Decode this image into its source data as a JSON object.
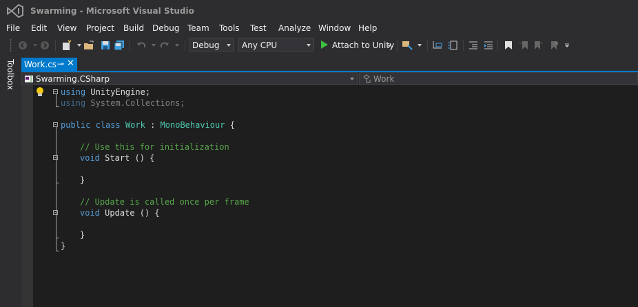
{
  "window": {
    "title": "Swarming - Microsoft Visual Studio"
  },
  "menu": [
    {
      "label": "File"
    },
    {
      "label": "Edit"
    },
    {
      "label": "View"
    },
    {
      "label": "Project"
    },
    {
      "label": "Build"
    },
    {
      "label": "Debug"
    },
    {
      "label": "Team"
    },
    {
      "label": "Tools"
    },
    {
      "label": "Test"
    },
    {
      "label": "Analyze"
    },
    {
      "label": "Window"
    },
    {
      "label": "Help"
    }
  ],
  "toolbar": {
    "configuration": "Debug",
    "platform": "Any CPU",
    "start_label": "Attach to Unity",
    "start_color": "#3fbf3f"
  },
  "sidepanel": {
    "toolbox_label": "Toolbox"
  },
  "tabs": [
    {
      "label": "Work.cs",
      "active": true
    }
  ],
  "navbar": {
    "project": "Swarming.CSharp",
    "class": "Work"
  },
  "code": {
    "lines": [
      [
        "using",
        " UnityEngine;"
      ],
      [
        "using",
        " System.Collections;"
      ],
      [
        "public",
        "class",
        "Work",
        ":",
        "MonoBehaviour",
        "{"
      ],
      [
        "// Use this for initialization"
      ],
      [
        "void",
        "Start",
        "() {"
      ],
      [
        "}"
      ],
      [
        "// Update is called once per frame"
      ],
      [
        "void",
        "Update",
        "() {"
      ],
      [
        "}"
      ],
      [
        "}"
      ]
    ]
  },
  "colors": {
    "accent": "#007acc",
    "keyword": "#569cd6",
    "type": "#4ec9b0",
    "comment": "#57a64a",
    "editor_bg": "#1e1e1e"
  }
}
